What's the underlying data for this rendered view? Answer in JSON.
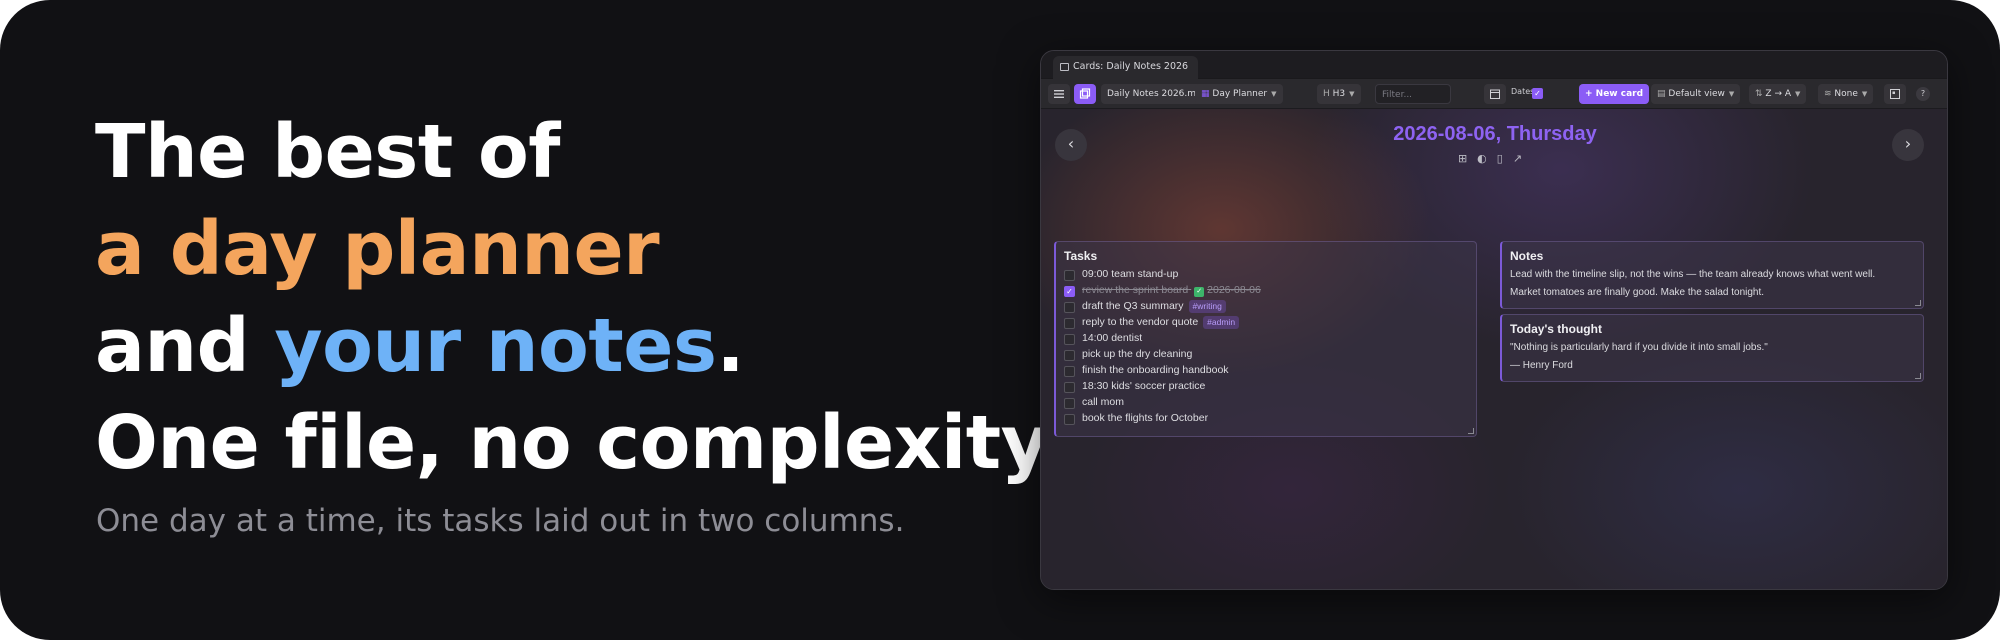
{
  "promo": {
    "line1": "The best of",
    "line2": "a day planner",
    "line3_prefix": "and ",
    "line3_highlight": "your notes",
    "line3_suffix": ".",
    "line4": "One file, no complexity.",
    "subtitle": "One day at a time, its tasks laid out in two columns."
  },
  "colors": {
    "accent_orange": "#f4a55d",
    "accent_blue": "#6eb2f7",
    "accent_purple": "#8b5cf6",
    "date_title": "#8e63f2"
  },
  "window": {
    "tab_title": "Cards: Daily Notes 2026",
    "toolbar": {
      "menu_icon": "hamburger-icon",
      "file_name": "Daily Notes 2026.md",
      "view_mode": "Day Planner",
      "heading_level": "H3",
      "filter_placeholder": "Filter...",
      "dates_label": "Dates",
      "new_card_label": "+ New card",
      "default_view_label": "Default view",
      "sort_label": "Z → A",
      "group_label": "None",
      "help_label": "?"
    },
    "day": {
      "title": "2026-08-06, Thursday",
      "prev_label": "‹",
      "next_label": "›"
    },
    "tasks_card": {
      "title": "Tasks",
      "items": [
        {
          "text": "09:00 team stand-up",
          "done": false
        },
        {
          "text": "review the sprint board",
          "done": true,
          "completed_date": "2026-08-06"
        },
        {
          "text": "draft the Q3 summary",
          "done": false,
          "tag": "#writing"
        },
        {
          "text": "reply to the vendor quote",
          "done": false,
          "tag": "#admin"
        },
        {
          "text": "14:00 dentist",
          "done": false
        },
        {
          "text": "pick up the dry cleaning",
          "done": false
        },
        {
          "text": "finish the onboarding handbook",
          "done": false
        },
        {
          "text": "18:30 kids' soccer practice",
          "done": false
        },
        {
          "text": "call mom",
          "done": false
        },
        {
          "text": "book the flights for October",
          "done": false
        }
      ]
    },
    "notes_card": {
      "title": "Notes",
      "lines": [
        "Lead with the timeline slip, not the wins — the team already knows what went well.",
        "Market tomatoes are finally good. Make the salad tonight."
      ]
    },
    "thought_card": {
      "title": "Today's thought",
      "quote": "\"Nothing is particularly hard if you divide it into small jobs.\"",
      "author": "— Henry Ford"
    }
  }
}
